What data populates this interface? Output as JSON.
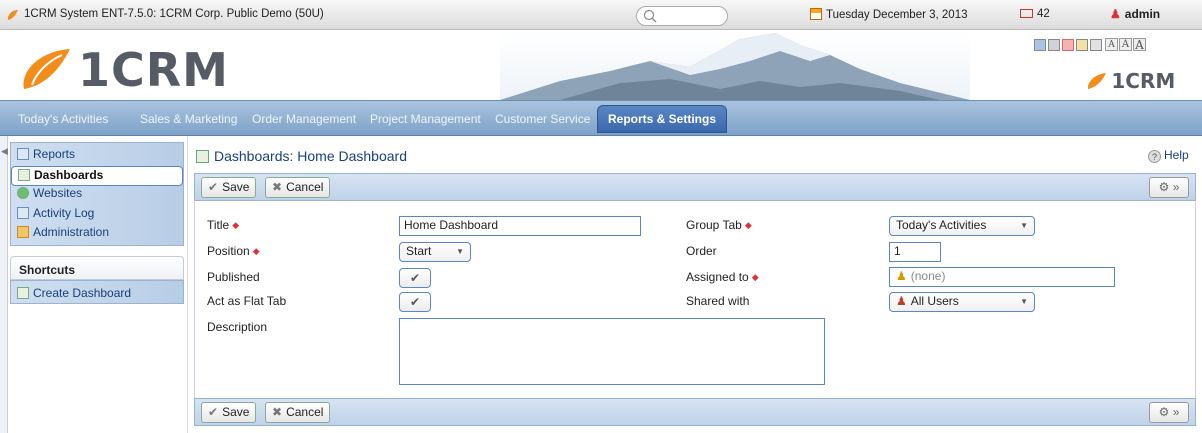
{
  "topbar": {
    "window_title": "1CRM System ENT-7.5.0: 1CRM Corp. Public Demo (50U)",
    "date": "Tuesday December 3, 2013",
    "mail_count": "42",
    "user": "admin"
  },
  "header": {
    "brand": "1CRM",
    "brand_small": "1CRM",
    "font_sizes": [
      "A",
      "A",
      "A"
    ],
    "style_swatches": [
      "#a8c4e6",
      "#cfd3d8",
      "#f2b3b3",
      "#f1e2a6",
      "#e2e2e2"
    ]
  },
  "nav": {
    "tabs": [
      "Today's Activities",
      "Sales & Marketing",
      "Order Management",
      "Project Management",
      "Customer Service",
      "Reports & Settings"
    ]
  },
  "sidebar": {
    "items": [
      "Reports",
      "Dashboards",
      "Websites",
      "Activity Log",
      "Administration"
    ],
    "shortcuts_title": "Shortcuts",
    "shortcut_item": "Create Dashboard"
  },
  "page": {
    "title": "Dashboards: Home Dashboard",
    "help": "Help"
  },
  "toolbar": {
    "save_label": "Save",
    "cancel_label": "Cancel"
  },
  "form": {
    "title_label": "Title",
    "title_value": "Home Dashboard",
    "position_label": "Position",
    "position_value": "Start",
    "published_label": "Published",
    "flat_tab_label": "Act as Flat Tab",
    "description_label": "Description",
    "group_tab_label": "Group Tab",
    "group_tab_value": "Today's Activities",
    "order_label": "Order",
    "order_value": "1",
    "assigned_label": "Assigned to",
    "assigned_value": "(none)",
    "shared_label": "Shared with",
    "shared_value": "All Users"
  }
}
